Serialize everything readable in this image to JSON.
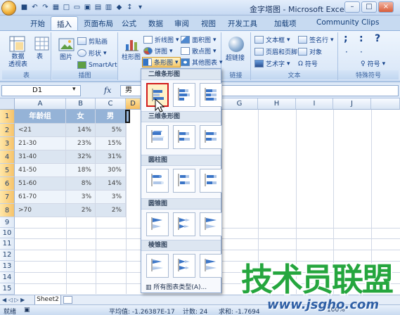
{
  "window": {
    "title": "金字塔图 - Microsoft Excel",
    "min": "–",
    "max": "□",
    "close": "×"
  },
  "tabs": [
    "开始",
    "插入",
    "页面布局",
    "公式",
    "数据",
    "审阅",
    "视图",
    "开发工具",
    "加载项",
    "Community Clips"
  ],
  "ribbon": {
    "groups": {
      "table": "表",
      "illustrations": "插图",
      "links": "链接",
      "text": "文本",
      "special_symbols": "特殊符号"
    },
    "buttons": {
      "pivot_table": "数据\n透视表",
      "table": "表",
      "picture": "图片",
      "clip_art": "剪贴画",
      "shapes": "形状",
      "smartart": "SmartArt",
      "column_chart": "柱形图",
      "line_chart": "折线图",
      "pie_chart": "饼图",
      "bar_chart": "条形图",
      "area_chart": "面积图",
      "scatter_chart": "散点图",
      "other_charts": "其他图表",
      "hyperlink": "超链接",
      "text_box": "文本框",
      "header_footer": "页眉和页脚",
      "wordart": "艺术字",
      "signature_line": "签名行",
      "object": "对象",
      "symbol": "符号",
      "symbol_right": "符号"
    },
    "symbols": [
      ";",
      ":",
      "?"
    ]
  },
  "formula_bar": {
    "name_box": "D1",
    "fx": "fx",
    "content": "男"
  },
  "sheet": {
    "columns": [
      "A",
      "B",
      "C",
      "D",
      "G",
      "H",
      "I",
      "J"
    ],
    "rows": [
      "1",
      "2",
      "3",
      "4",
      "5",
      "6",
      "7",
      "8",
      "9",
      "10",
      "11",
      "12",
      "13",
      "14",
      "15"
    ],
    "headers": [
      "年龄组",
      "女",
      "男"
    ],
    "data": [
      [
        "<21",
        "14%",
        "5%"
      ],
      [
        "21-30",
        "23%",
        "15%"
      ],
      [
        "31-40",
        "32%",
        "31%"
      ],
      [
        "41-50",
        "18%",
        "30%"
      ],
      [
        "51-60",
        "8%",
        "14%"
      ],
      [
        "61-70",
        "3%",
        "3%"
      ],
      [
        ">70",
        "2%",
        "2%"
      ]
    ]
  },
  "dropdown": {
    "sections": [
      "二维条形图",
      "三维条形图",
      "圆柱图",
      "圆锥图",
      "棱锥图"
    ],
    "all_chart_types": "所有图表类型(A)..."
  },
  "sheet_tab": "Sheet2",
  "status": {
    "ready": "就绪",
    "average": "平均值: -1.26387E-17",
    "count": "计数: 24",
    "sum": "求和: -1.7694",
    "zoom": "100%"
  },
  "watermark": {
    "main": "技术员联盟",
    "url": "www.jsgho.com",
    "corner": "网"
  }
}
